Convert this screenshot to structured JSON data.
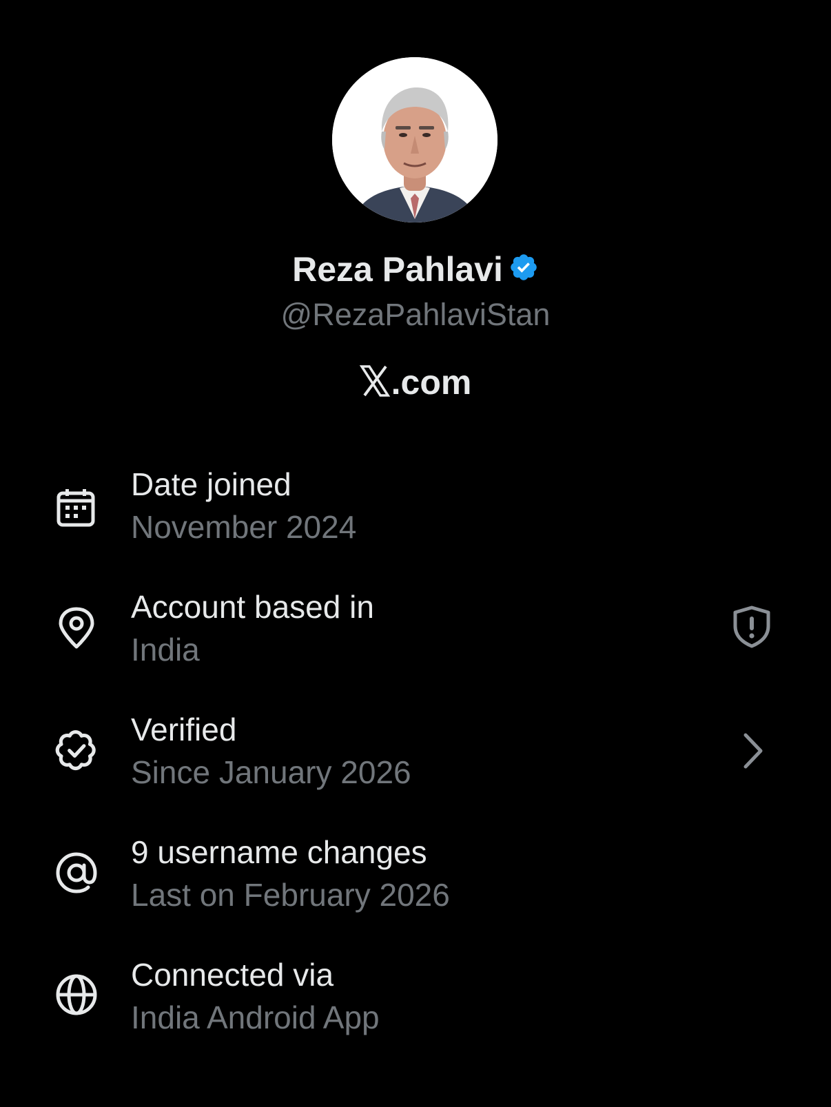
{
  "profile": {
    "display_name": "Reza Pahlavi",
    "handle": "@RezaPahlaviStan",
    "site": ".com",
    "site_logo": "x-logo",
    "verified_badge_icon": "verified-badge-icon",
    "accent_color": "#1d9bf0"
  },
  "info": [
    {
      "title": "Date joined",
      "subtitle": "November 2024",
      "icon": "calendar-icon"
    },
    {
      "title": "Account based in",
      "subtitle": "India",
      "icon": "location-pin-icon",
      "trailing_icon": "shield-alert-icon"
    },
    {
      "title": "Verified",
      "subtitle": "Since January 2026",
      "icon": "verified-check-icon",
      "trailing_icon": "chevron-right-icon"
    },
    {
      "title": "9 username changes",
      "subtitle": "Last on February 2026",
      "icon": "at-sign-icon"
    },
    {
      "title": "Connected via",
      "subtitle": "India Android App",
      "icon": "globe-icon"
    }
  ]
}
